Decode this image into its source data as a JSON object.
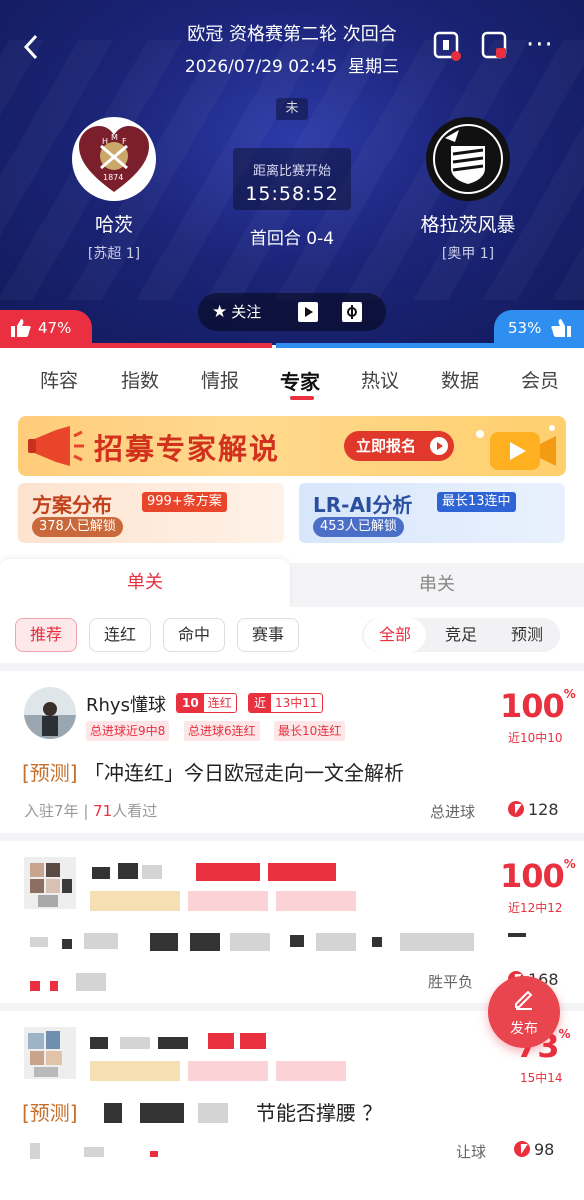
{
  "header": {
    "title": "欧冠 资格赛第二轮 次回合",
    "datetime": "2026/07/29 02:45",
    "weekday": "星期三",
    "status": "未",
    "countdown_label": "距离比赛开始",
    "countdown": "15:58:52",
    "first_leg": "首回合 0-4",
    "home": {
      "name": "哈茨",
      "league": "[苏超 1]"
    },
    "away": {
      "name": "格拉茨风暴",
      "league": "[奥甲 1]"
    },
    "follow_label": "关注",
    "vote_home": "47%",
    "vote_away": "53%",
    "vote_home_fraction": 0.47
  },
  "tabs": [
    "阵容",
    "指数",
    "情报",
    "专家",
    "热议",
    "数据",
    "会员"
  ],
  "active_tab": "专家",
  "banner": {
    "text": "招募专家解说",
    "cta": "立即报名"
  },
  "cards": {
    "left": {
      "title": "方案分布",
      "tag": "999+条方案",
      "sub": "378人已解锁"
    },
    "right": {
      "title": "LR-AI分析",
      "tag": "最长13连中",
      "sub": "453人已解锁"
    }
  },
  "subtabs": {
    "left": "单关",
    "right": "串关"
  },
  "chips": [
    "推荐",
    "连红",
    "命中",
    "赛事"
  ],
  "segments": [
    "全部",
    "竞足",
    "预测"
  ],
  "posts": [
    {
      "author": "Rhys懂球",
      "streak_num": "10",
      "streak_label": "连红",
      "recent_label": "近",
      "recent_value": "13中11",
      "stats": [
        "总进球近9中8",
        "总进球6连红",
        "最长10连红"
      ],
      "pct": "100",
      "pct_unit": "%",
      "pct_sub": "近10中10",
      "tag": "[预测]",
      "title": "「冲连红」今日欧冠走向一文全解析",
      "joined": "入驻7年",
      "views_num": "71",
      "views_label": "人看过",
      "play_type": "总进球",
      "heat": "128"
    },
    {
      "pct": "100",
      "pct_unit": "%",
      "pct_sub": "近12中12",
      "play_type": "胜平负",
      "heat": "168"
    },
    {
      "pct": "73",
      "pct_unit": "%",
      "pct_sub": "15中14",
      "tag": "[预测]",
      "title_tail": "节能否撑腰   ？",
      "play_type": "让球",
      "heat": "98"
    }
  ],
  "fab_label": "发布",
  "colors": {
    "accent": "#e8303f",
    "home_vote": "#ea3040",
    "away_vote": "#2f8ff0",
    "header_bg": "#1b2478"
  }
}
